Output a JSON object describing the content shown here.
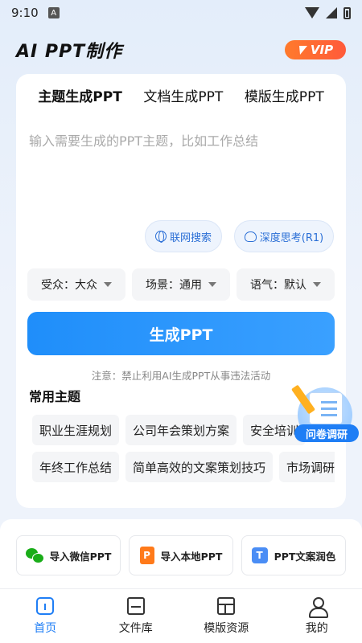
{
  "status_bar": {
    "time": "9:10",
    "notif_letter": "A"
  },
  "header": {
    "title": "AI PPT制作",
    "vip_label": "VIP"
  },
  "tabs": [
    {
      "label": "主题生成PPT",
      "active": true
    },
    {
      "label": "文档生成PPT",
      "active": false
    },
    {
      "label": "模版生成PPT",
      "active": false
    }
  ],
  "topic_input": {
    "placeholder": "输入需要生成的PPT主题，比如工作总结",
    "value": ""
  },
  "options": {
    "web_search": "联网搜索",
    "deep_think": "深度思考(R1)"
  },
  "selectors": [
    {
      "label": "受众：大众"
    },
    {
      "label": "场景：通用"
    },
    {
      "label": "语气：默认"
    }
  ],
  "generate_button": "生成PPT",
  "notice": "注意：禁止利用AI生成PPT从事违法活动",
  "common_topics": {
    "title": "常用主题",
    "row1": [
      "职业生涯规划",
      "公司年会策划方案",
      "安全培训"
    ],
    "row2": [
      "年终工作总结",
      "简单高效的文案策划技巧",
      "市场调研"
    ]
  },
  "survey": {
    "label": "问卷调研"
  },
  "imports": [
    {
      "label": "导入微信PPT",
      "icon": "wechat-icon"
    },
    {
      "label": "导入本地PPT",
      "icon": "ppt-file-icon",
      "glyph": "P"
    },
    {
      "label": "PPT文案润色",
      "icon": "text-polish-icon",
      "glyph": "T"
    }
  ],
  "bottom_nav": [
    {
      "label": "首页",
      "icon": "home-icon",
      "active": true
    },
    {
      "label": "文件库",
      "icon": "folder-icon",
      "active": false
    },
    {
      "label": "模版资源",
      "icon": "template-icon",
      "active": false
    },
    {
      "label": "我的",
      "icon": "user-icon",
      "active": false
    }
  ],
  "colors": {
    "accent": "#1f8efa",
    "vip": "#ff6a32",
    "wechat": "#1aad19"
  }
}
